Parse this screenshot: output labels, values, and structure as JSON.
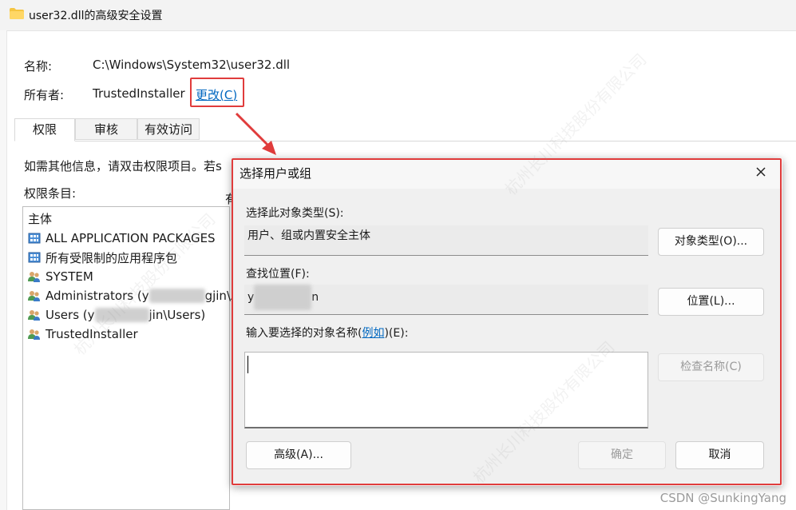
{
  "window": {
    "title": "user32.dll的高级安全设置"
  },
  "details": {
    "name_label": "名称:",
    "name_value": "C:\\Windows\\System32\\user32.dll",
    "owner_label": "所有者:",
    "owner_value": "TrustedInstaller",
    "change_link": "更改(C)"
  },
  "tabs": [
    {
      "label": "权限",
      "active": true
    },
    {
      "label": "审核",
      "active": false
    },
    {
      "label": "有效访问",
      "active": false
    }
  ],
  "info_text": "如需其他信息，请双击权限项目。若s",
  "entries_label": "权限条目:",
  "entries_header_partial": "有",
  "principals": {
    "header": "主体",
    "items": [
      {
        "label": "ALL APPLICATION PACKAGES",
        "icon": "app-packages-icon"
      },
      {
        "label": "所有受限制的应用程序包",
        "icon": "app-packages-icon"
      },
      {
        "label": "SYSTEM",
        "icon": "group-icon"
      },
      {
        "label": "Administrators (y",
        "suffix": "gjin\\A",
        "icon": "group-icon"
      },
      {
        "label": "Users (y",
        "suffix": "jin\\Users)",
        "icon": "group-icon"
      },
      {
        "label": "TrustedInstaller",
        "icon": "group-icon"
      }
    ]
  },
  "dialog": {
    "title": "选择用户或组",
    "object_type_label": "选择此对象类型(S):",
    "object_type_value": "用户、组或内置安全主体",
    "object_type_button": "对象类型(O)...",
    "location_label": "查找位置(F):",
    "location_value": "y",
    "location_value_suffix": "n",
    "location_button": "位置(L)...",
    "enter_names_label_pre": "输入要选择的对象名称(",
    "enter_names_link": "例如",
    "enter_names_label_post": ")(E):",
    "check_names_button": "检查名称(C)",
    "advanced_button": "高级(A)...",
    "ok_button": "确定",
    "cancel_button": "取消"
  },
  "watermark": {
    "footer": "CSDN @SunkingYang",
    "text": "杭州长川科技股份有限公司"
  },
  "colors": {
    "highlight_border": "#e03c3c",
    "link": "#0067c0"
  }
}
